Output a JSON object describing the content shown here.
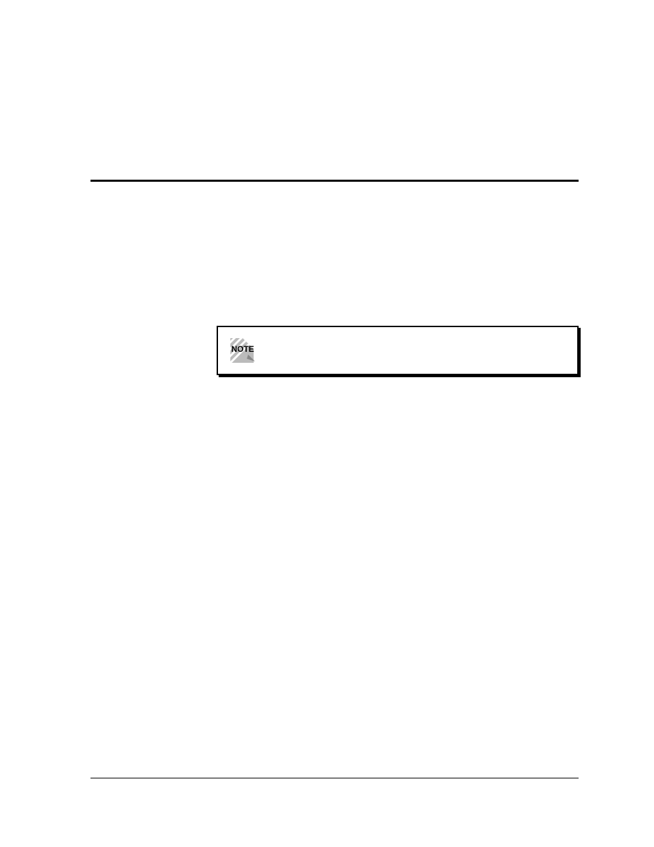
{
  "note": {
    "label": "NOTE"
  }
}
